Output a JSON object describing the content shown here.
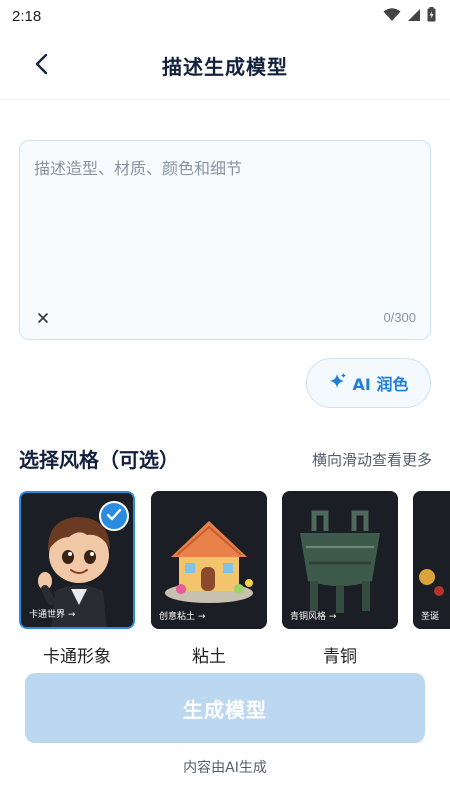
{
  "status_bar": {
    "time": "2:18"
  },
  "header": {
    "title": "描述生成模型"
  },
  "prompt": {
    "placeholder": "描述造型、材质、颜色和细节",
    "value": "",
    "char_count": "0/300"
  },
  "ai_polish": {
    "label": "AI 润色"
  },
  "styles_section": {
    "title": "选择风格（可选）",
    "scroll_hint": "横向滑动查看更多",
    "items": [
      {
        "name": "卡通形象",
        "caption": "卡通世界 →",
        "selected": true
      },
      {
        "name": "粘土",
        "caption": "创意粘土 →",
        "selected": false
      },
      {
        "name": "青铜",
        "caption": "青铜风格 →",
        "selected": false
      },
      {
        "name": "",
        "caption": "圣诞",
        "selected": false
      }
    ]
  },
  "generate": {
    "label": "生成模型"
  },
  "footer": {
    "notice": "内容由AI生成"
  },
  "colors": {
    "accent": "#2a8be0",
    "generate_disabled": "#bcd8f1",
    "title": "#14213d"
  }
}
